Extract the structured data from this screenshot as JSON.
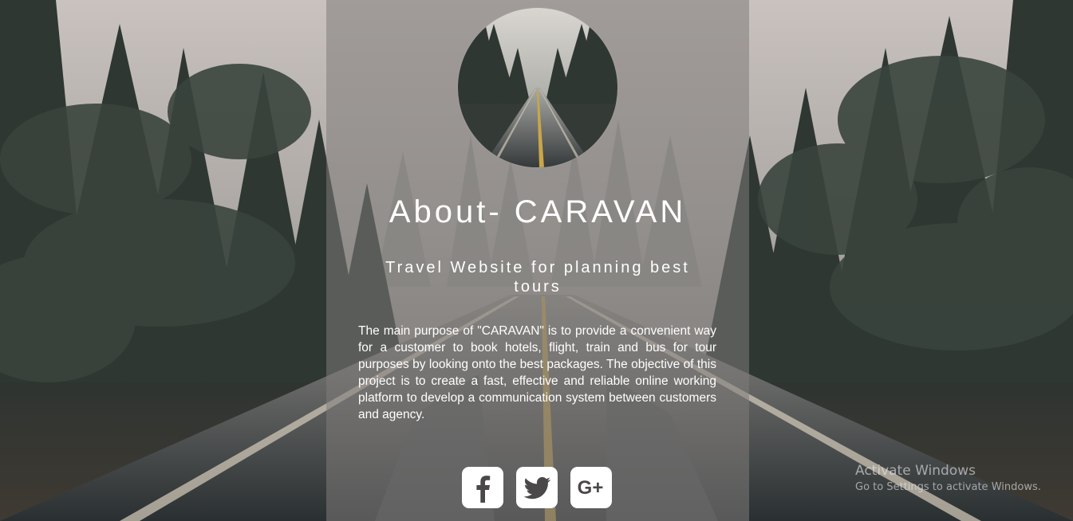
{
  "about": {
    "title": "About- CARAVAN",
    "subtitle": "Travel Website for planning best tours",
    "description": "The main purpose of \"CARAVAN\" is to provide a convenient way for a customer to book hotels, flight, train and bus for tour purposes by looking onto the best packages. The objective of this project is to create a fast, effective and reliable online working platform to develop a communication system between customers and agency."
  },
  "social": [
    {
      "name": "facebook",
      "icon": "facebook-icon"
    },
    {
      "name": "twitter",
      "icon": "twitter-icon"
    },
    {
      "name": "google-plus",
      "icon": "google-plus-icon",
      "glyph": "G+"
    }
  ],
  "watermark": {
    "title": "Activate Windows",
    "subtitle": "Go to Settings to activate Windows."
  },
  "colors": {
    "panel": "#807c7a",
    "text": "#ffffff",
    "icon": "#4a4848",
    "sky": "#c7c0bd",
    "forest": "#2c3531"
  }
}
